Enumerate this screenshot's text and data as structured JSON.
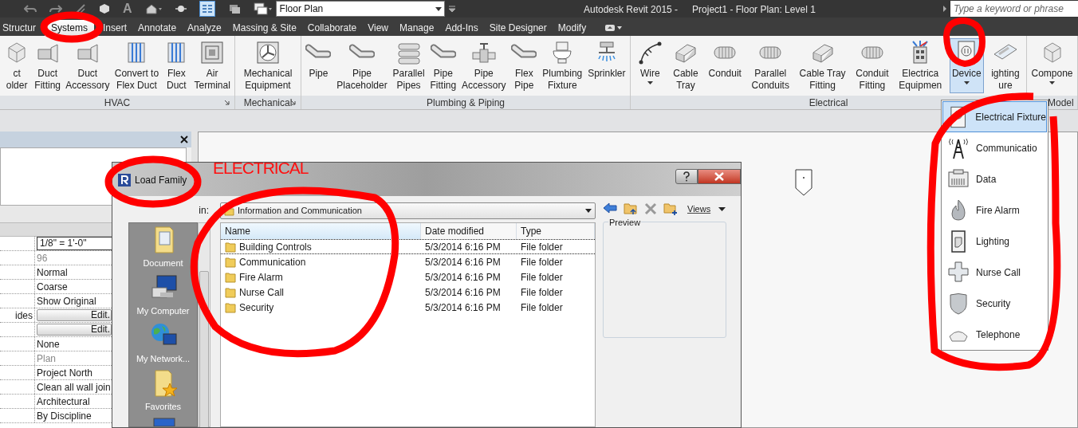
{
  "title_bar": {
    "quick_access_text": "A",
    "view_selector": "Floor Plan",
    "app_title": "Autodesk Revit 2015 -",
    "document_title": "Project1 - Floor Plan: Level 1",
    "search": {
      "placeholder": "Type a keyword or phrase"
    }
  },
  "tabs": [
    {
      "label": "Structur",
      "selected": false
    },
    {
      "label": "Systems",
      "selected": true
    },
    {
      "label": "Insert",
      "selected": false
    },
    {
      "label": "Annotate",
      "selected": false
    },
    {
      "label": "Analyze",
      "selected": false
    },
    {
      "label": "Massing & Site",
      "selected": false
    },
    {
      "label": "Collaborate",
      "selected": false
    },
    {
      "label": "View",
      "selected": false
    },
    {
      "label": "Manage",
      "selected": false
    },
    {
      "label": "Add-Ins",
      "selected": false
    },
    {
      "label": "Site Designer",
      "selected": false
    },
    {
      "label": "Modify",
      "selected": false
    }
  ],
  "ribbon": {
    "panels": [
      {
        "title": "HVAC",
        "launcher": true,
        "buttons": [
          {
            "lines": [
              "ct",
              "older"
            ],
            "pressed": false,
            "dropdown": false
          },
          {
            "lines": [
              "Duct",
              "Fitting"
            ],
            "pressed": false,
            "dropdown": false
          },
          {
            "lines": [
              "Duct",
              "Accessory"
            ],
            "pressed": false,
            "dropdown": false
          },
          {
            "lines": [
              "Convert to",
              "Flex Duct"
            ],
            "pressed": false,
            "dropdown": false
          },
          {
            "lines": [
              "Flex",
              "Duct"
            ],
            "pressed": false,
            "dropdown": false
          },
          {
            "lines": [
              "Air",
              "Terminal"
            ],
            "pressed": false,
            "dropdown": false
          }
        ]
      },
      {
        "title": "Mechanical",
        "launcher": true,
        "buttons": [
          {
            "lines": [
              "Mechanical",
              "Equipment"
            ],
            "pressed": false,
            "dropdown": false
          }
        ]
      },
      {
        "title": "Plumbing & Piping",
        "launcher": false,
        "buttons": [
          {
            "lines": [
              "Pipe"
            ],
            "pressed": false,
            "dropdown": false
          },
          {
            "lines": [
              "Pipe",
              "Placeholder"
            ],
            "pressed": false,
            "dropdown": false
          },
          {
            "lines": [
              "Parallel",
              "Pipes"
            ],
            "pressed": false,
            "dropdown": false
          },
          {
            "lines": [
              "Pipe",
              "Fitting"
            ],
            "pressed": false,
            "dropdown": false
          },
          {
            "lines": [
              "Pipe",
              "Accessory"
            ],
            "pressed": false,
            "dropdown": false
          },
          {
            "lines": [
              "Flex",
              "Pipe"
            ],
            "pressed": false,
            "dropdown": false
          },
          {
            "lines": [
              "Plumbing",
              "Fixture"
            ],
            "pressed": false,
            "dropdown": false
          },
          {
            "lines": [
              "Sprinkler"
            ],
            "pressed": false,
            "dropdown": false
          }
        ]
      },
      {
        "title": "Electrical",
        "launcher": false,
        "buttons": [
          {
            "lines": [
              "Wire"
            ],
            "pressed": false,
            "dropdown": true
          },
          {
            "lines": [
              "Cable",
              "Tray"
            ],
            "pressed": false,
            "dropdown": false
          },
          {
            "lines": [
              "Conduit"
            ],
            "pressed": false,
            "dropdown": false
          },
          {
            "lines": [
              "Parallel",
              "Conduits"
            ],
            "pressed": false,
            "dropdown": false
          },
          {
            "lines": [
              "Cable Tray",
              "Fitting"
            ],
            "pressed": false,
            "dropdown": false
          },
          {
            "lines": [
              "Conduit",
              "Fitting"
            ],
            "pressed": false,
            "dropdown": false
          },
          {
            "lines": [
              "Electrica",
              "Equipmen"
            ],
            "pressed": false,
            "dropdown": false
          },
          {
            "lines": [
              "Device"
            ],
            "pressed": true,
            "dropdown": true
          },
          {
            "lines": [
              "ighting",
              "ure"
            ],
            "pressed": false,
            "dropdown": false
          }
        ]
      },
      {
        "title": "Model",
        "launcher": false,
        "buttons": [
          {
            "lines": [
              "Compone"
            ],
            "pressed": false,
            "dropdown": true
          }
        ]
      }
    ]
  },
  "properties": {
    "rows": [
      {
        "kind": "box",
        "value": "1/8\" = 1'-0\""
      },
      {
        "kind": "muted",
        "value": "96"
      },
      {
        "kind": "text",
        "value": "Normal"
      },
      {
        "kind": "text",
        "value": "Coarse"
      },
      {
        "kind": "text",
        "value": "Show Original"
      },
      {
        "kind": "button",
        "label": "ides",
        "value": "Edit."
      },
      {
        "kind": "button",
        "value": "Edit."
      },
      {
        "kind": "text",
        "value": "None"
      },
      {
        "kind": "muted",
        "value": "Plan"
      },
      {
        "kind": "text",
        "value": "Project North"
      },
      {
        "kind": "text",
        "value": "Clean all wall join"
      },
      {
        "kind": "text",
        "value": "Architectural"
      },
      {
        "kind": "text",
        "value": "By Discipline"
      }
    ]
  },
  "dialog": {
    "title": "Load Family",
    "look_in_label": "in:",
    "look_in": "Information and Communication",
    "views_label": "Views",
    "preview_label": "Preview",
    "places": [
      {
        "label": "Document"
      },
      {
        "label": "My Computer"
      },
      {
        "label": "My Network..."
      },
      {
        "label": "Favorites"
      }
    ],
    "columns": [
      "Name",
      "Date modified",
      "Type"
    ],
    "files": [
      {
        "name": "Building Controls",
        "date": "5/3/2014 6:16 PM",
        "type": "File folder",
        "selected": true
      },
      {
        "name": "Communication",
        "date": "5/3/2014 6:16 PM",
        "type": "File folder",
        "selected": false
      },
      {
        "name": "Fire Alarm",
        "date": "5/3/2014 6:16 PM",
        "type": "File folder",
        "selected": false
      },
      {
        "name": "Nurse Call",
        "date": "5/3/2014 6:16 PM",
        "type": "File folder",
        "selected": false
      },
      {
        "name": "Security",
        "date": "5/3/2014 6:16 PM",
        "type": "File folder",
        "selected": false
      }
    ]
  },
  "device_menu": {
    "items": [
      {
        "label": "Electrical Fixture",
        "selected": true
      },
      {
        "label": "Communicatio",
        "selected": false
      },
      {
        "label": "Data",
        "selected": false
      },
      {
        "label": "Fire Alarm",
        "selected": false
      },
      {
        "label": "Lighting",
        "selected": false
      },
      {
        "label": "Nurse Call",
        "selected": false
      },
      {
        "label": "Security",
        "selected": false
      },
      {
        "label": "Telephone",
        "selected": false
      }
    ]
  },
  "annotation": {
    "text": "ELECTRICAL"
  }
}
